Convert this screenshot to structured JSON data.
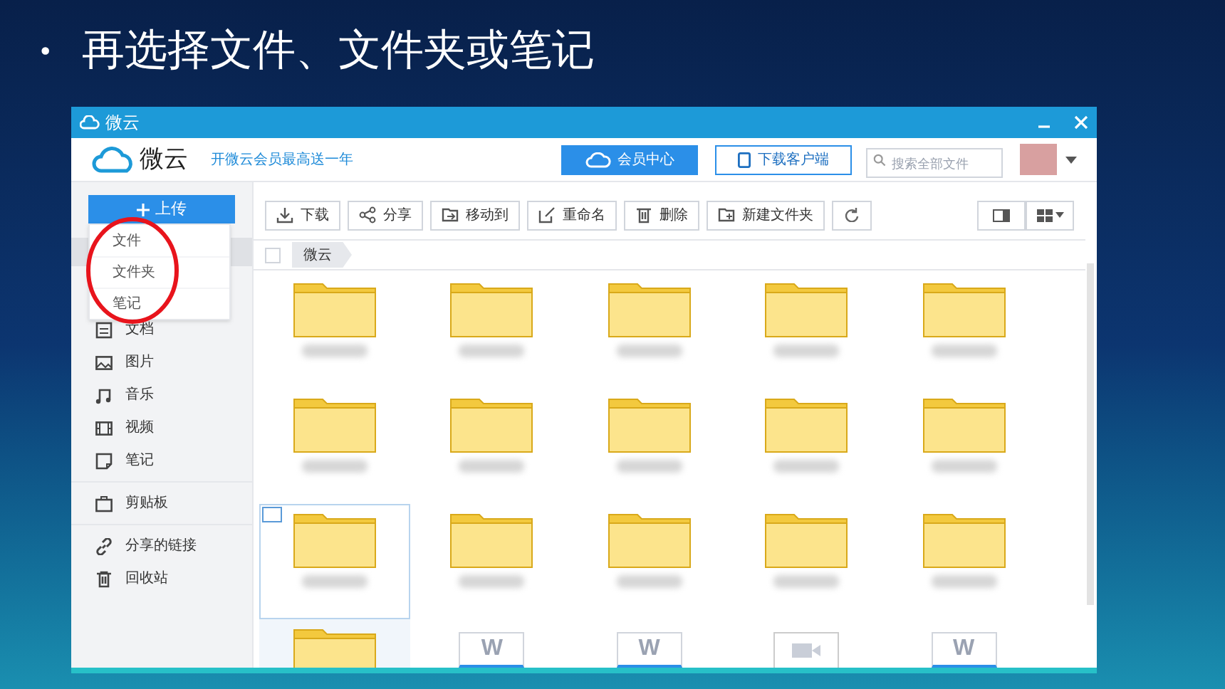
{
  "slide": {
    "bullet": "•",
    "title": "再选择文件、文件夹或笔记"
  },
  "window": {
    "title": "微云"
  },
  "header": {
    "logo": "微云",
    "promo": "开微云会员最高送一年",
    "buttons": [
      {
        "label": "会员中心",
        "kind": "primary"
      },
      {
        "label": "下载客户端",
        "kind": "outline"
      }
    ],
    "search": {
      "placeholder": "搜索全部文件"
    }
  },
  "upload": {
    "label": "上传",
    "menu": [
      {
        "label": "文件"
      },
      {
        "label": "文件夹"
      },
      {
        "label": "笔记"
      }
    ]
  },
  "sidebar": {
    "groups": [
      [
        {
          "label": "文档"
        },
        {
          "label": "图片"
        },
        {
          "label": "音乐"
        },
        {
          "label": "视频"
        },
        {
          "label": "笔记"
        }
      ],
      [
        {
          "label": "剪贴板"
        }
      ],
      [
        {
          "label": "分享的链接"
        },
        {
          "label": "回收站"
        }
      ]
    ]
  },
  "toolbar": {
    "buttons": [
      {
        "label": "下载"
      },
      {
        "label": "分享"
      },
      {
        "label": "移动到"
      },
      {
        "label": "重命名"
      },
      {
        "label": "删除"
      },
      {
        "label": "新建文件夹"
      }
    ]
  },
  "breadcrumb": {
    "select_all_checked": false,
    "items": [
      "微云"
    ]
  },
  "files": [
    {
      "kind": "folder",
      "selected": false,
      "highlighted": false,
      "name_hidden": true
    },
    {
      "kind": "folder",
      "selected": false,
      "highlighted": false,
      "name_hidden": true
    },
    {
      "kind": "folder",
      "selected": false,
      "highlighted": false,
      "name_hidden": true
    },
    {
      "kind": "folder",
      "selected": false,
      "highlighted": false,
      "name_hidden": true
    },
    {
      "kind": "folder",
      "selected": false,
      "highlighted": false,
      "name_hidden": true
    },
    {
      "kind": "folder",
      "selected": false,
      "highlighted": false,
      "name_hidden": true
    },
    {
      "kind": "folder",
      "selected": false,
      "highlighted": false,
      "name_hidden": true
    },
    {
      "kind": "folder",
      "selected": false,
      "highlighted": false,
      "name_hidden": true
    },
    {
      "kind": "folder",
      "selected": false,
      "highlighted": false,
      "name_hidden": true
    },
    {
      "kind": "folder",
      "selected": false,
      "highlighted": false,
      "name_hidden": true
    },
    {
      "kind": "folder",
      "selected": true,
      "highlighted": false,
      "name_hidden": true
    },
    {
      "kind": "folder",
      "selected": false,
      "highlighted": false,
      "name_hidden": true
    },
    {
      "kind": "folder",
      "selected": false,
      "highlighted": false,
      "name_hidden": true
    },
    {
      "kind": "folder",
      "selected": false,
      "highlighted": false,
      "name_hidden": true
    },
    {
      "kind": "folder",
      "selected": false,
      "highlighted": false,
      "name_hidden": true
    },
    {
      "kind": "folder",
      "selected": false,
      "highlighted": true
    },
    {
      "kind": "doc",
      "letter": "W",
      "selected": false,
      "highlighted": false
    },
    {
      "kind": "doc",
      "letter": "W",
      "selected": false,
      "highlighted": false
    },
    {
      "kind": "video",
      "selected": false,
      "highlighted": false
    },
    {
      "kind": "doc",
      "letter": "W",
      "selected": false,
      "highlighted": false
    }
  ]
}
